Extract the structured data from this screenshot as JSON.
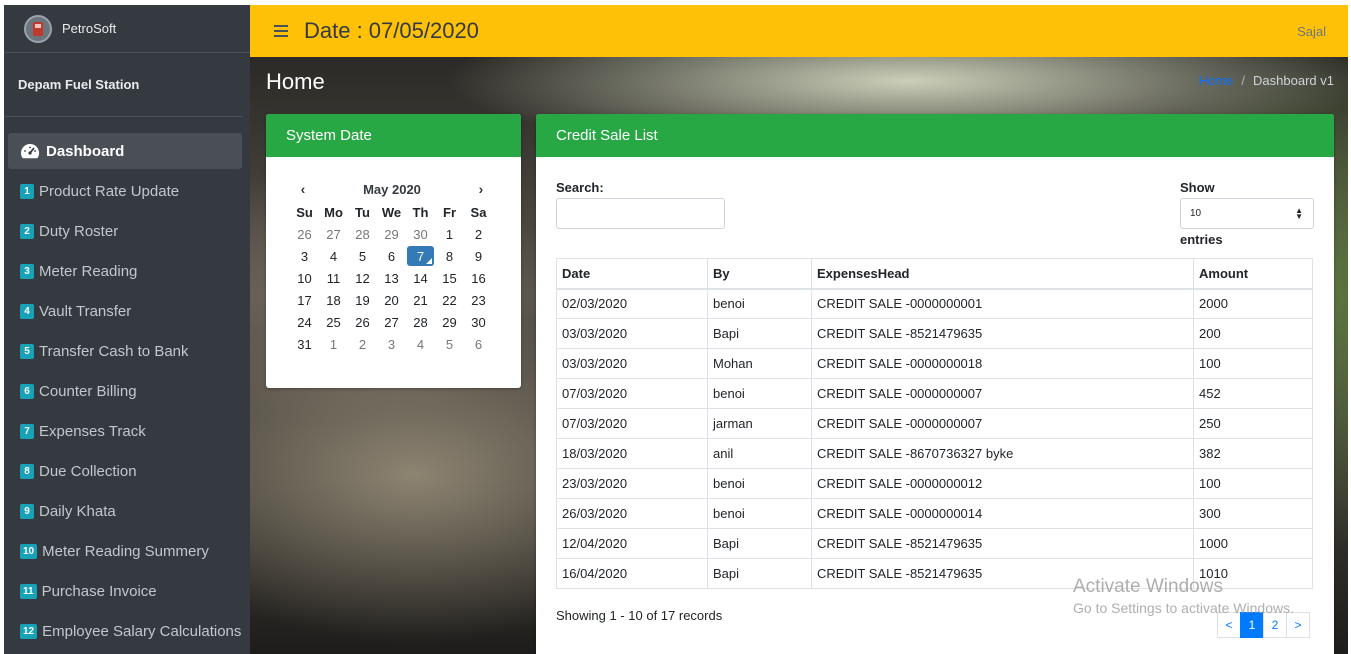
{
  "brand": {
    "name": "PetroSoft"
  },
  "station": "Depam Fuel Station",
  "sidebar": {
    "items": [
      {
        "label": "Dashboard"
      },
      {
        "num": "1",
        "label": "Product Rate Update"
      },
      {
        "num": "2",
        "label": "Duty Roster"
      },
      {
        "num": "3",
        "label": "Meter Reading"
      },
      {
        "num": "4",
        "label": "Vault Transfer"
      },
      {
        "num": "5",
        "label": "Transfer Cash to Bank"
      },
      {
        "num": "6",
        "label": "Counter Billing"
      },
      {
        "num": "7",
        "label": "Expenses Track"
      },
      {
        "num": "8",
        "label": "Due Collection"
      },
      {
        "num": "9",
        "label": "Daily Khata"
      },
      {
        "num": "10",
        "label": "Meter Reading Summery"
      },
      {
        "num": "11",
        "label": "Purchase Invoice"
      },
      {
        "num": "12",
        "label": "Employee Salary Calculations"
      }
    ]
  },
  "header": {
    "date_title": "Date : 07/05/2020",
    "user": "Sajal"
  },
  "page": {
    "title": "Home",
    "breadcrumb_home": "Home",
    "breadcrumb_sep": "/",
    "breadcrumb_current": "Dashboard v1"
  },
  "calendar": {
    "card_title": "System Date",
    "month_label": "May 2020",
    "prev": "‹",
    "next": "›",
    "dow": [
      "Su",
      "Mo",
      "Tu",
      "We",
      "Th",
      "Fr",
      "Sa"
    ],
    "weeks": [
      [
        "26",
        "27",
        "28",
        "29",
        "30",
        "1",
        "2"
      ],
      [
        "3",
        "4",
        "5",
        "6",
        "7",
        "8",
        "9"
      ],
      [
        "10",
        "11",
        "12",
        "13",
        "14",
        "15",
        "16"
      ],
      [
        "17",
        "18",
        "19",
        "20",
        "21",
        "22",
        "23"
      ],
      [
        "24",
        "25",
        "26",
        "27",
        "28",
        "29",
        "30"
      ],
      [
        "31",
        "1",
        "2",
        "3",
        "4",
        "5",
        "6"
      ]
    ],
    "selected_day": "7"
  },
  "sales": {
    "card_title": "Credit Sale List",
    "search_label": "Search:",
    "show_label": "Show",
    "entries_value": "10",
    "entries_label": "entries",
    "columns": [
      "Date",
      "By",
      "ExpensesHead",
      "Amount"
    ],
    "rows": [
      [
        "02/03/2020",
        "benoi",
        "CREDIT SALE -0000000001",
        "2000"
      ],
      [
        "03/03/2020",
        "Bapi",
        "CREDIT SALE -8521479635",
        "200"
      ],
      [
        "03/03/2020",
        "Mohan",
        "CREDIT SALE -0000000018",
        "100"
      ],
      [
        "07/03/2020",
        "benoi",
        "CREDIT SALE -0000000007",
        "452"
      ],
      [
        "07/03/2020",
        "jarman",
        "CREDIT SALE -0000000007",
        "250"
      ],
      [
        "18/03/2020",
        "anil",
        "CREDIT SALE -8670736327 byke",
        "382"
      ],
      [
        "23/03/2020",
        "benoi",
        "CREDIT SALE -0000000012",
        "100"
      ],
      [
        "26/03/2020",
        "benoi",
        "CREDIT SALE -0000000014",
        "300"
      ],
      [
        "12/04/2020",
        "Bapi",
        "CREDIT SALE -8521479635",
        "1000"
      ],
      [
        "16/04/2020",
        "Bapi",
        "CREDIT SALE -8521479635",
        "1010"
      ]
    ],
    "records_text": "Showing 1 - 10 of 17 records",
    "pager": {
      "prev": "<",
      "pages": [
        "1",
        "2"
      ],
      "current": "1",
      "next": ">"
    }
  },
  "watermark": {
    "line1": "Activate Windows",
    "line2": "Go to Settings to activate Windows."
  },
  "colors": {
    "header": "#ffc107",
    "card_header": "#28a745",
    "sidebar": "#343a40",
    "accent": "#007bff",
    "badge": "#17a2b8"
  }
}
